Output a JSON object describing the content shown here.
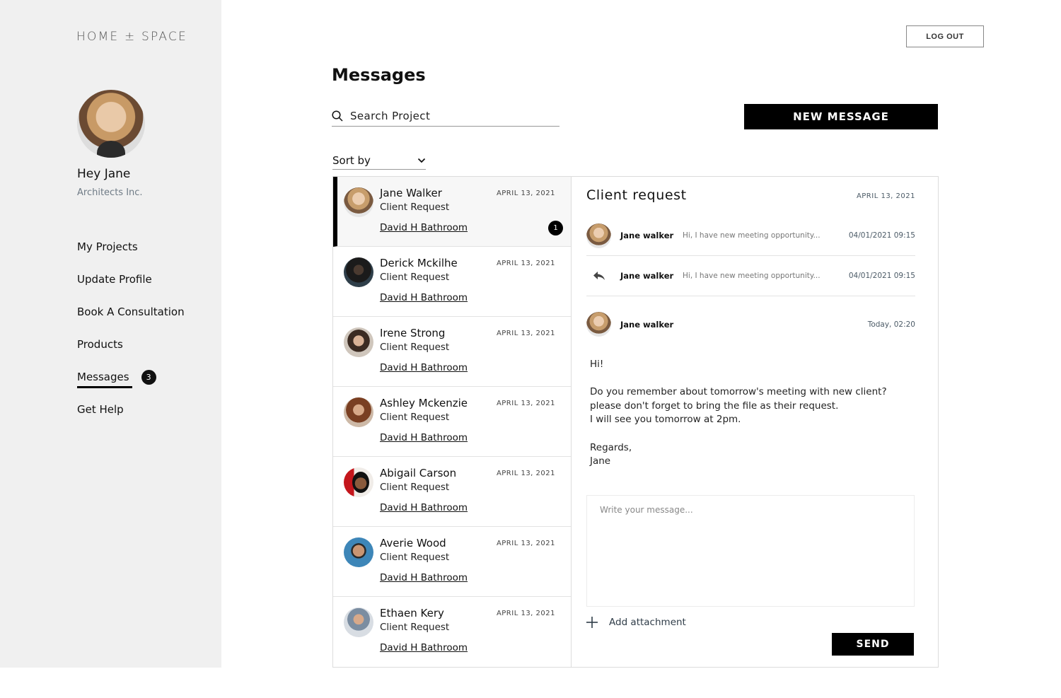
{
  "brand": {
    "logo": "HOME ± SPACE"
  },
  "user": {
    "greeting": "Hey Jane",
    "company": "Architects Inc."
  },
  "nav": {
    "items": [
      {
        "label": "My Projects"
      },
      {
        "label": "Update Profile"
      },
      {
        "label": "Book A Consultation"
      },
      {
        "label": "Products"
      },
      {
        "label": "Messages",
        "badge": "3",
        "active": true
      },
      {
        "label": "Get Help"
      }
    ]
  },
  "header": {
    "logout_label": "LOG OUT",
    "title": "Messages"
  },
  "search": {
    "placeholder": "Search Project"
  },
  "toolbar": {
    "new_message_label": "NEW MESSAGE",
    "sort_label": "Sort by"
  },
  "conversations": [
    {
      "name": "Jane Walker",
      "subject": "Client Request",
      "project": "David H Bathroom",
      "date": "APRIL 13, 2021",
      "unread": "1"
    },
    {
      "name": "Derick Mckilhe",
      "subject": "Client Request",
      "project": "David H Bathroom",
      "date": "APRIL 13, 2021"
    },
    {
      "name": "Irene Strong",
      "subject": "Client Request",
      "project": "David H Bathroom",
      "date": "APRIL 13, 2021"
    },
    {
      "name": "Ashley Mckenzie",
      "subject": "Client Request",
      "project": "David H Bathroom",
      "date": "APRIL 13, 2021"
    },
    {
      "name": "Abigail Carson",
      "subject": "Client Request",
      "project": "David H Bathroom",
      "date": "APRIL 13, 2021"
    },
    {
      "name": "Averie Wood",
      "subject": "Client Request",
      "project": "David H Bathroom",
      "date": "APRIL 13, 2021"
    },
    {
      "name": "Ethaen Kery",
      "subject": "Client Request",
      "project": "David H Bathroom",
      "date": "APRIL 13, 2021"
    }
  ],
  "detail": {
    "title": "Client request",
    "date": "APRIL 13, 2021",
    "thread": [
      {
        "sender": "Jane walker",
        "preview": "Hi, I have new meeting opportunity...",
        "datetime": "04/01/2021  09:15"
      },
      {
        "sender": "Jane walker",
        "preview": "Hi, I have new meeting opportunity...",
        "datetime": "04/01/2021  09:15"
      }
    ],
    "open_message": {
      "sender": "Jane walker",
      "time": "Today, 02:20",
      "lines": {
        "l1": "Hi!",
        "l2": "Do you remember about tomorrow's meeting with new client?",
        "l3": "please don't forget to bring the file as their request.",
        "l4": "I will see you tomorrow at 2pm.",
        "l5": "Regards,",
        "l6": "Jane"
      }
    },
    "compose_placeholder": "Write your message...",
    "attach_label": "Add attachment",
    "send_label": "SEND"
  }
}
